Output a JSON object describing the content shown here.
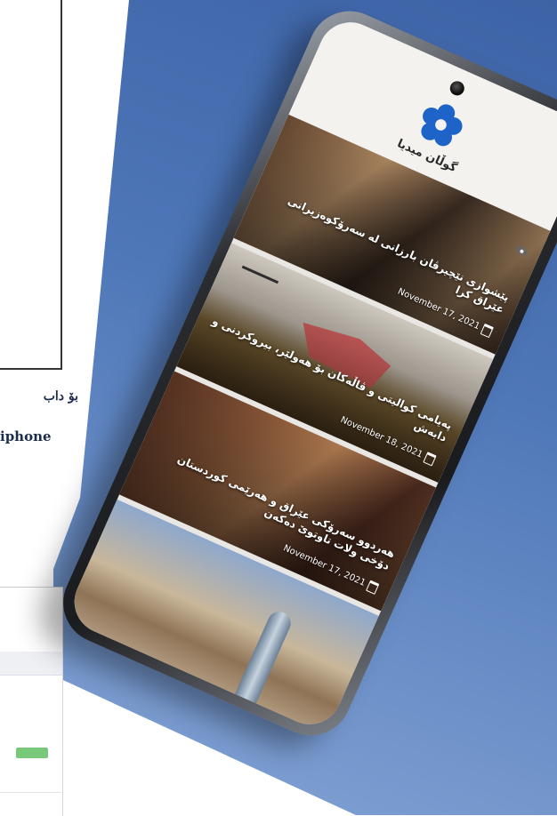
{
  "side_text": {
    "line1": "بۆ داب",
    "line2": "iphone"
  },
  "app": {
    "title": "گوڵان میدیا",
    "accent_color": "#1e64c8",
    "logo_icon": "flower-logo-icon",
    "settings_icon": "gear-icon"
  },
  "articles": [
    {
      "title": "پێشوازی نێچیرڤان بارزانی لە سەرۆکوەزیرانی عێراق کرا",
      "date": "November 17, 2021"
    },
    {
      "title": "پەیامی کوالیتی و ڤاڵەکان بۆ هەولێر، بیروکردنی و دابەش",
      "date": "November 18, 2021"
    },
    {
      "title": "هەردوو سەرۆکی عێراق و هەرێمی کوردستان دۆخی ولات تاوتوێ دەکەن",
      "date": "November 17, 2021"
    },
    {
      "title": "",
      "date": ""
    }
  ]
}
